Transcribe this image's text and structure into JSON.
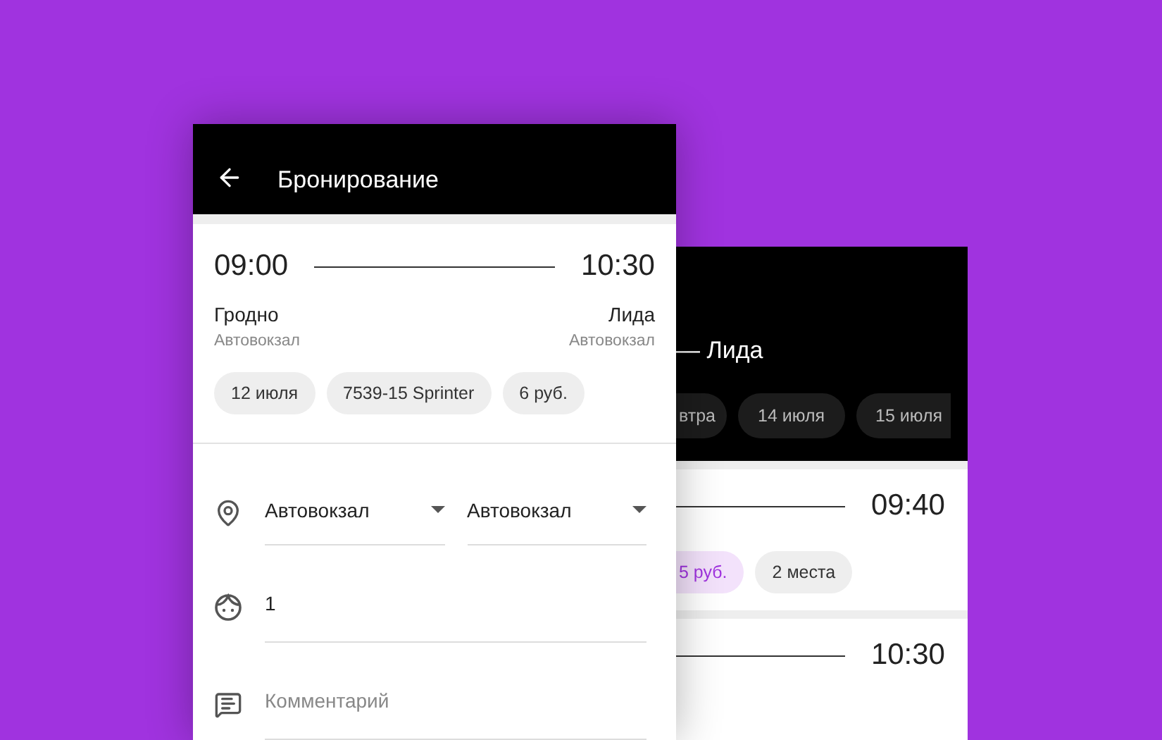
{
  "background_screen": {
    "title": "— Лида",
    "dates": [
      {
        "label": "втра"
      },
      {
        "label": "14 июля"
      },
      {
        "label": "15 июля"
      }
    ],
    "trips": [
      {
        "arrival": "09:40",
        "chips": [
          {
            "label": "5 руб.",
            "kind": "price"
          },
          {
            "label": "2 места",
            "kind": "plain"
          }
        ]
      },
      {
        "arrival": "10:30"
      }
    ]
  },
  "booking": {
    "title": "Бронирование",
    "trip": {
      "departure_time": "09:00",
      "arrival_time": "10:30",
      "from_city": "Гродно",
      "from_station": "Автовокзал",
      "to_city": "Лида",
      "to_station": "Автовокзал",
      "chips": [
        "12 июля",
        "7539-15 Sprinter",
        "6 руб."
      ]
    },
    "stops": [
      "Автовокзал",
      "Автовокзал"
    ],
    "passengers": "1",
    "comment": {
      "placeholder": "Комментарий"
    }
  }
}
